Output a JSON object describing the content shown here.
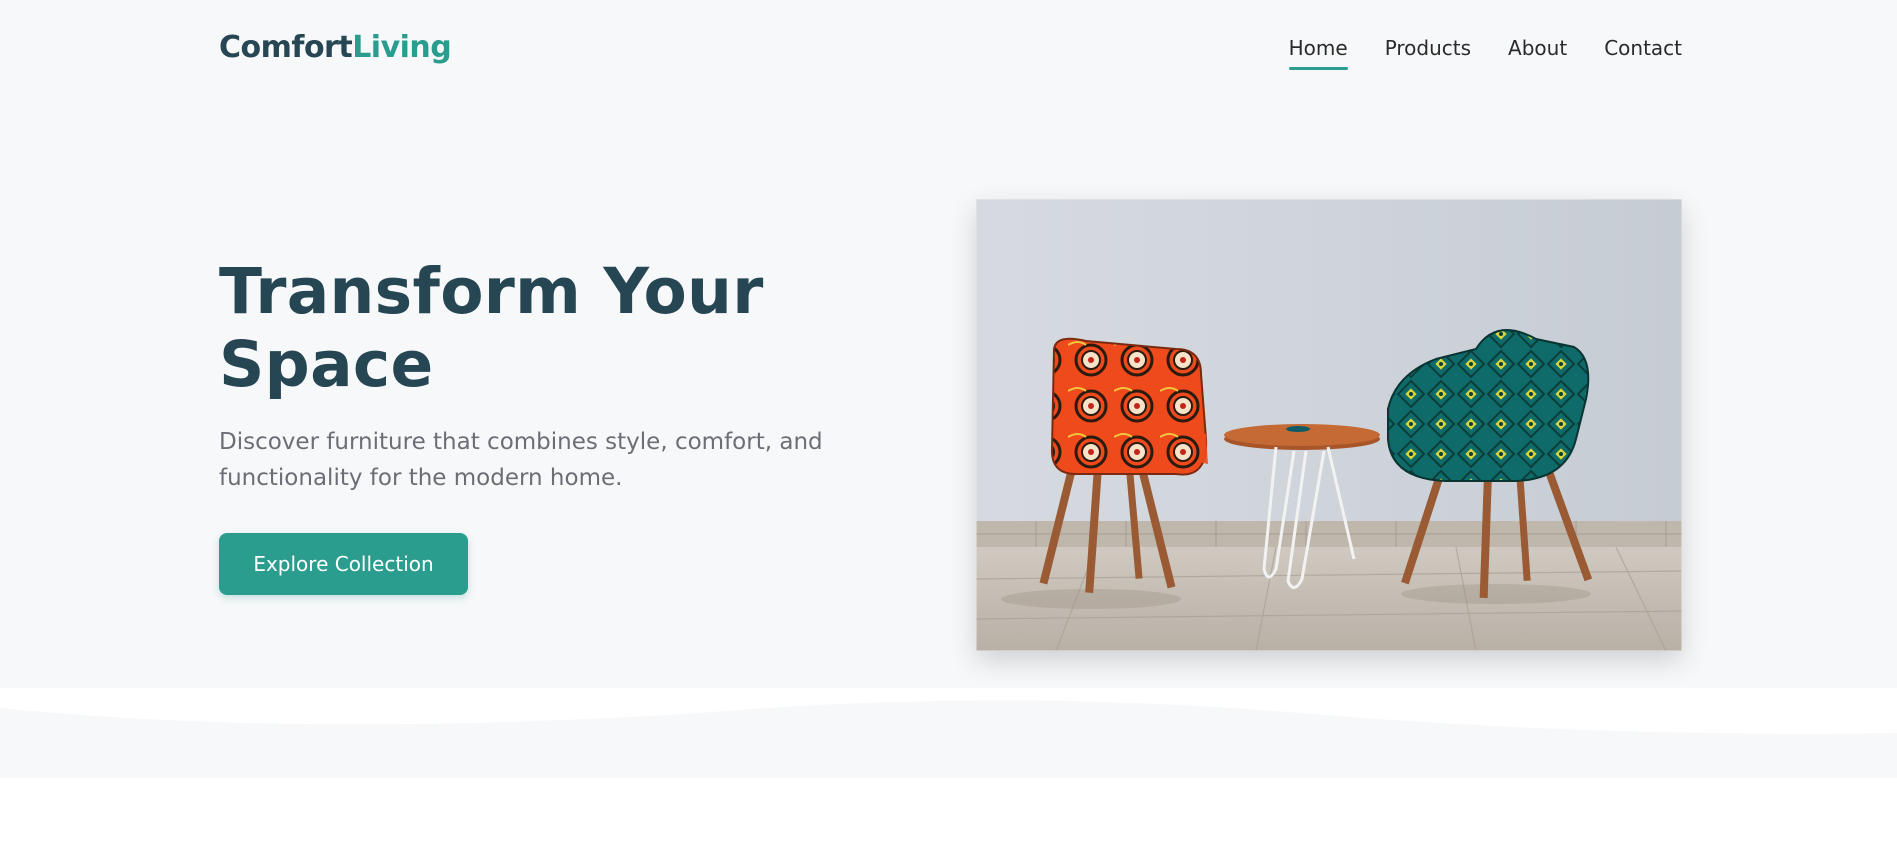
{
  "header": {
    "logo_part1": "Comfort",
    "logo_part2": "Living",
    "nav": [
      {
        "label": "Home",
        "active": true
      },
      {
        "label": "Products",
        "active": false
      },
      {
        "label": "About",
        "active": false
      },
      {
        "label": "Contact",
        "active": false
      }
    ]
  },
  "hero": {
    "title_line1": "Transform Your",
    "title_line2": "Space",
    "subtitle_line1": "Discover furniture that combines style, comfort, and",
    "subtitle_line2": "functionality for the modern home.",
    "cta_label": "Explore Collection",
    "image_subject": "two patterned armchairs with a round side table"
  },
  "colors": {
    "brand_dark": "#264653",
    "brand_accent": "#2a9d8f",
    "background": "#f7f8fa"
  }
}
